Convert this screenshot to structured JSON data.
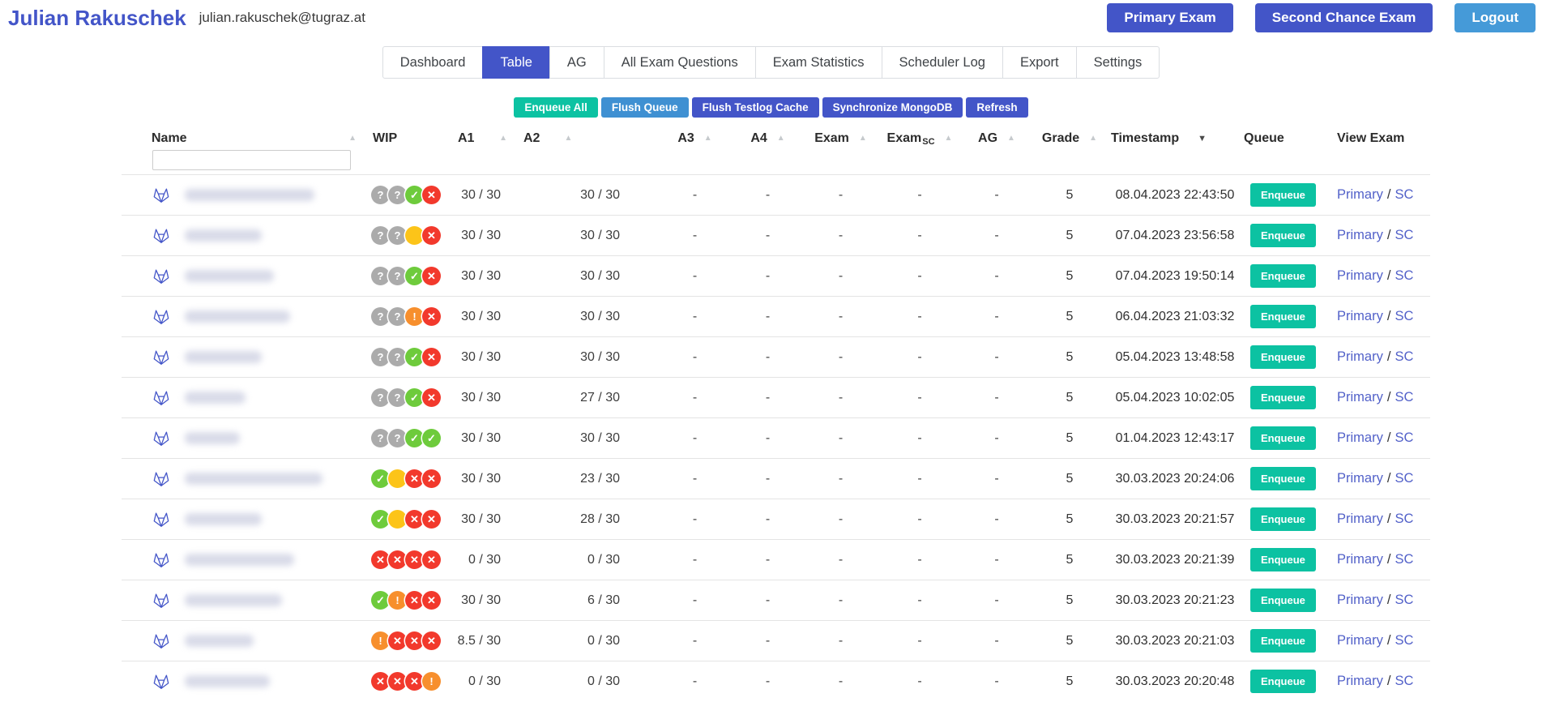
{
  "colors": {
    "indigo": "#4355c8",
    "sky": "#459ad8",
    "sky_dark": "#3f90d2",
    "teal": "#0cc2a2",
    "status_gray": "#ababab",
    "status_green": "#6ecb3c",
    "status_red": "#f2392c",
    "status_orange": "#f78f2d",
    "status_yellow": "#fcc419",
    "link": "#5261c9"
  },
  "header": {
    "user_name": "Julian Rakuschek",
    "user_email": "julian.rakuschek@tugraz.at",
    "buttons": [
      {
        "id": "primary-exam",
        "label": "Primary Exam",
        "style": "indigo"
      },
      {
        "id": "second-chance-exam",
        "label": "Second Chance Exam",
        "style": "indigo"
      },
      {
        "id": "logout",
        "label": "Logout",
        "style": "sky"
      }
    ]
  },
  "tabs": [
    {
      "id": "dashboard",
      "label": "Dashboard",
      "active": false
    },
    {
      "id": "table",
      "label": "Table",
      "active": true
    },
    {
      "id": "ag",
      "label": "AG",
      "active": false
    },
    {
      "id": "all-exam-questions",
      "label": "All Exam Questions",
      "active": false
    },
    {
      "id": "exam-statistics",
      "label": "Exam Statistics",
      "active": false
    },
    {
      "id": "scheduler-log",
      "label": "Scheduler Log",
      "active": false
    },
    {
      "id": "export",
      "label": "Export",
      "active": false
    },
    {
      "id": "settings",
      "label": "Settings",
      "active": false
    }
  ],
  "actions": [
    {
      "id": "enqueue-all",
      "label": "Enqueue All",
      "style": "teal"
    },
    {
      "id": "flush-queue",
      "label": "Flush Queue",
      "style": "sky"
    },
    {
      "id": "flush-testlog-cache",
      "label": "Flush Testlog Cache",
      "style": "indigo"
    },
    {
      "id": "synchronize-mongodb",
      "label": "Synchronize MongoDB",
      "style": "indigo"
    },
    {
      "id": "refresh",
      "label": "Refresh",
      "style": "indigo"
    }
  ],
  "table": {
    "filter": {
      "value": "",
      "placeholder": ""
    },
    "columns": [
      {
        "id": "name",
        "label": "Name",
        "sort": "asc"
      },
      {
        "id": "wip",
        "label": "WIP"
      },
      {
        "id": "a1",
        "label": "A1",
        "sort": "asc"
      },
      {
        "id": "a2",
        "label": "A2",
        "sort": "asc"
      },
      {
        "id": "a3",
        "label": "A3",
        "sort": "asc"
      },
      {
        "id": "a4",
        "label": "A4",
        "sort": "asc"
      },
      {
        "id": "exam",
        "label": "Exam",
        "sort": "asc"
      },
      {
        "id": "exam_sc",
        "label": "Exam",
        "sub": "SC",
        "sort": "asc"
      },
      {
        "id": "ag",
        "label": "AG",
        "sort": "asc"
      },
      {
        "id": "grade",
        "label": "Grade",
        "sort": "asc"
      },
      {
        "id": "timestamp",
        "label": "Timestamp",
        "sort": "desc-active"
      },
      {
        "id": "queue",
        "label": "Queue"
      },
      {
        "id": "view_exam",
        "label": "View Exam"
      }
    ],
    "queue_button_label": "Enqueue",
    "view_links": {
      "primary": "Primary",
      "separator": "/",
      "sc": "SC"
    },
    "rows": [
      {
        "wip": [
          "question",
          "question",
          "check",
          "cross"
        ],
        "a1": "30 / 30",
        "a2": "30 / 30",
        "a3": "-",
        "a4": "-",
        "exam": "-",
        "exam_sc": "-",
        "ag": "-",
        "grade": "5",
        "timestamp": "08.04.2023 22:43:50",
        "name_redacted_width": 160
      },
      {
        "wip": [
          "question",
          "question",
          "dot",
          "cross"
        ],
        "a1": "30 / 30",
        "a2": "30 / 30",
        "a3": "-",
        "a4": "-",
        "exam": "-",
        "exam_sc": "-",
        "ag": "-",
        "grade": "5",
        "timestamp": "07.04.2023 23:56:58",
        "name_redacted_width": 95
      },
      {
        "wip": [
          "question",
          "question",
          "check",
          "cross"
        ],
        "a1": "30 / 30",
        "a2": "30 / 30",
        "a3": "-",
        "a4": "-",
        "exam": "-",
        "exam_sc": "-",
        "ag": "-",
        "grade": "5",
        "timestamp": "07.04.2023 19:50:14",
        "name_redacted_width": 110
      },
      {
        "wip": [
          "question",
          "question",
          "warn",
          "cross"
        ],
        "a1": "30 / 30",
        "a2": "30 / 30",
        "a3": "-",
        "a4": "-",
        "exam": "-",
        "exam_sc": "-",
        "ag": "-",
        "grade": "5",
        "timestamp": "06.04.2023 21:03:32",
        "name_redacted_width": 130
      },
      {
        "wip": [
          "question",
          "question",
          "check",
          "cross"
        ],
        "a1": "30 / 30",
        "a2": "30 / 30",
        "a3": "-",
        "a4": "-",
        "exam": "-",
        "exam_sc": "-",
        "ag": "-",
        "grade": "5",
        "timestamp": "05.04.2023 13:48:58",
        "name_redacted_width": 95
      },
      {
        "wip": [
          "question",
          "question",
          "check",
          "cross"
        ],
        "a1": "30 / 30",
        "a2": "27 / 30",
        "a3": "-",
        "a4": "-",
        "exam": "-",
        "exam_sc": "-",
        "ag": "-",
        "grade": "5",
        "timestamp": "05.04.2023 10:02:05",
        "name_redacted_width": 75
      },
      {
        "wip": [
          "question",
          "question",
          "check",
          "check"
        ],
        "a1": "30 / 30",
        "a2": "30 / 30",
        "a3": "-",
        "a4": "-",
        "exam": "-",
        "exam_sc": "-",
        "ag": "-",
        "grade": "5",
        "timestamp": "01.04.2023 12:43:17",
        "name_redacted_width": 68
      },
      {
        "wip": [
          "check",
          "dot",
          "cross",
          "cross"
        ],
        "a1": "30 / 30",
        "a2": "23 / 30",
        "a3": "-",
        "a4": "-",
        "exam": "-",
        "exam_sc": "-",
        "ag": "-",
        "grade": "5",
        "timestamp": "30.03.2023 20:24:06",
        "name_redacted_width": 170
      },
      {
        "wip": [
          "check",
          "dot",
          "cross",
          "cross"
        ],
        "a1": "30 / 30",
        "a2": "28 / 30",
        "a3": "-",
        "a4": "-",
        "exam": "-",
        "exam_sc": "-",
        "ag": "-",
        "grade": "5",
        "timestamp": "30.03.2023 20:21:57",
        "name_redacted_width": 95
      },
      {
        "wip": [
          "cross",
          "cross",
          "cross",
          "cross"
        ],
        "a1": "0 / 30",
        "a2": "0 / 30",
        "a3": "-",
        "a4": "-",
        "exam": "-",
        "exam_sc": "-",
        "ag": "-",
        "grade": "5",
        "timestamp": "30.03.2023 20:21:39",
        "name_redacted_width": 135
      },
      {
        "wip": [
          "check",
          "warn",
          "cross",
          "cross"
        ],
        "a1": "30 / 30",
        "a2": "6 / 30",
        "a3": "-",
        "a4": "-",
        "exam": "-",
        "exam_sc": "-",
        "ag": "-",
        "grade": "5",
        "timestamp": "30.03.2023 20:21:23",
        "name_redacted_width": 120
      },
      {
        "wip": [
          "warn",
          "cross",
          "cross",
          "cross"
        ],
        "a1": "8.5 / 30",
        "a2": "0 / 30",
        "a3": "-",
        "a4": "-",
        "exam": "-",
        "exam_sc": "-",
        "ag": "-",
        "grade": "5",
        "timestamp": "30.03.2023 20:21:03",
        "name_redacted_width": 85
      },
      {
        "wip": [
          "cross",
          "cross",
          "cross",
          "warn"
        ],
        "a1": "0 / 30",
        "a2": "0 / 30",
        "a3": "-",
        "a4": "-",
        "exam": "-",
        "exam_sc": "-",
        "ag": "-",
        "grade": "5",
        "timestamp": "30.03.2023 20:20:48",
        "name_redacted_width": 105
      }
    ]
  }
}
